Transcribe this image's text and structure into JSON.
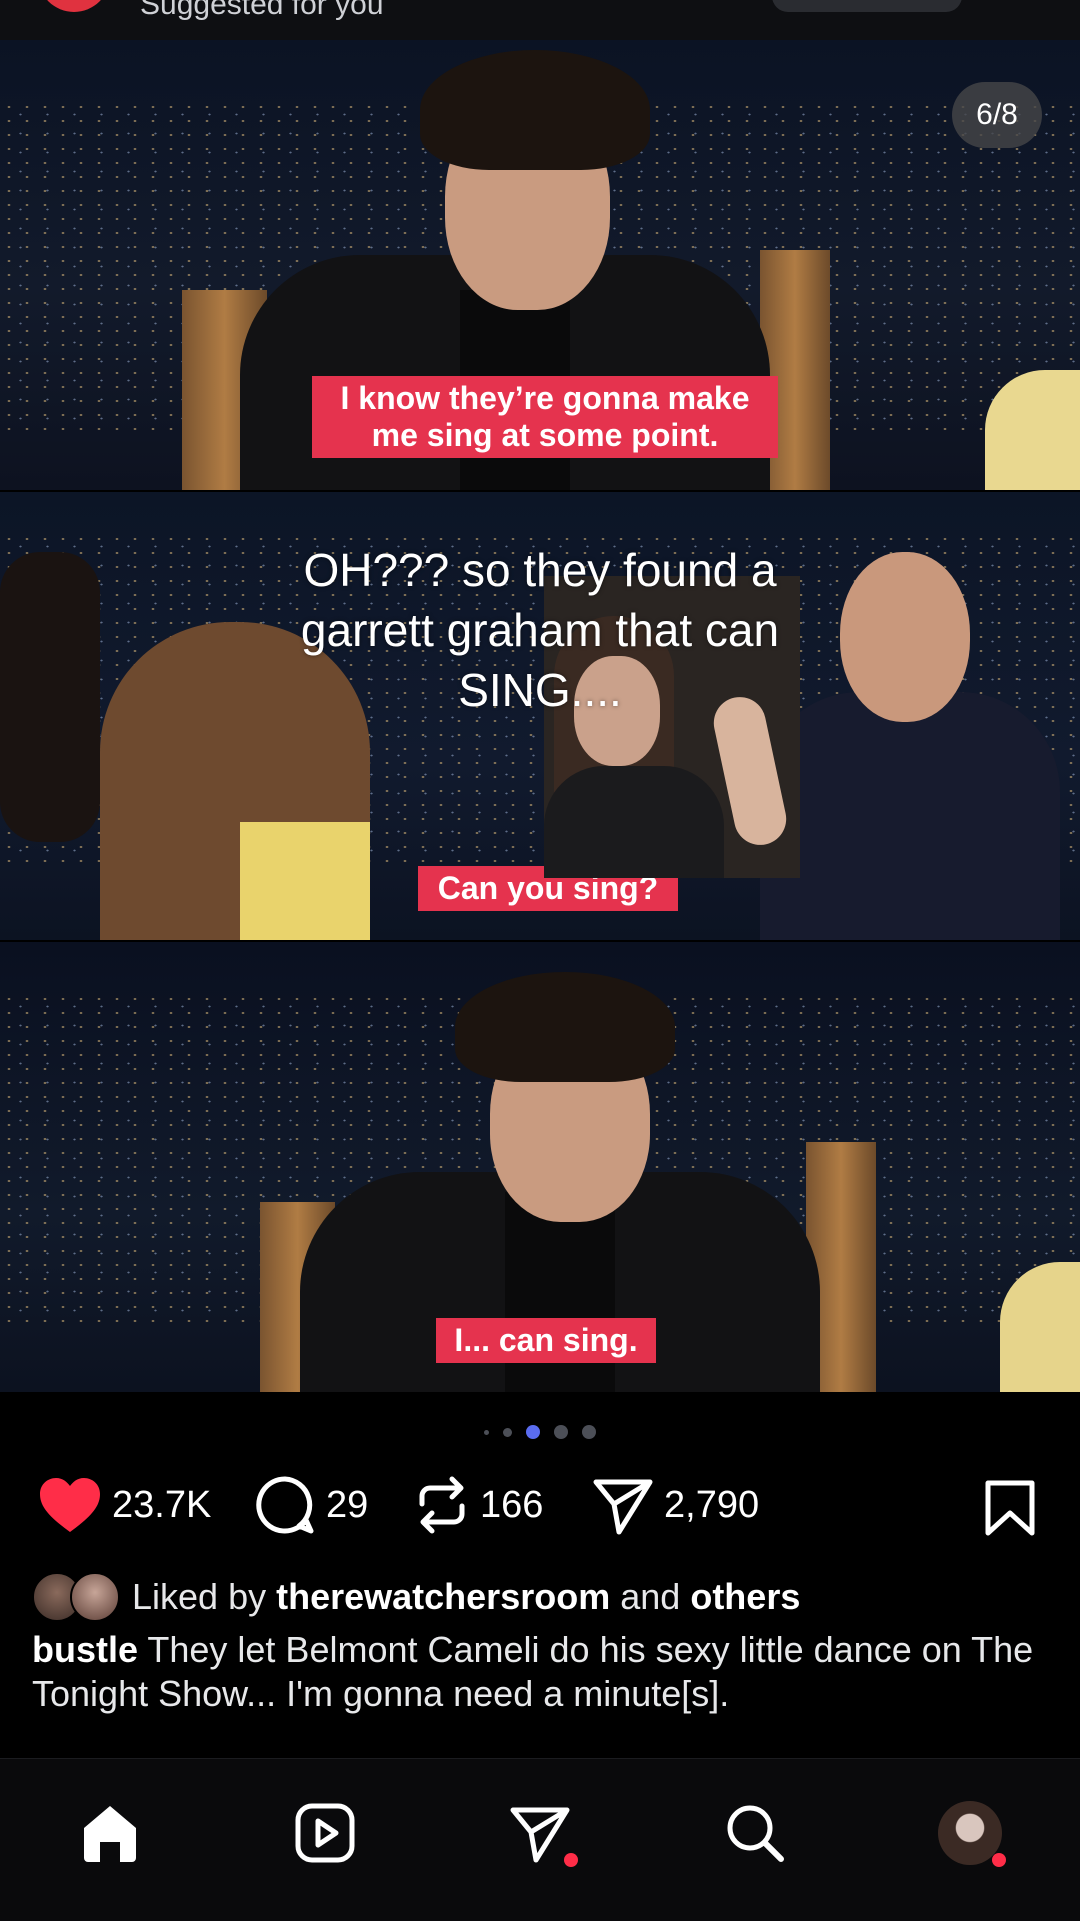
{
  "top_bar": {
    "label": "Suggested for you"
  },
  "media": {
    "counter": "6/8",
    "captions": [
      "I know they’re gonna make",
      "me sing at some point.",
      "Can you sing?",
      "I... can sing."
    ],
    "overlay_lines": [
      "OH??? so they found a",
      "garrett graham that can",
      "SING...."
    ]
  },
  "carousel": {
    "dots": 5,
    "active_index": 2
  },
  "actions": {
    "likes": "23.7K",
    "comments": "29",
    "reposts": "166",
    "shares": "2,790",
    "accent_color": "#ff2d48"
  },
  "liked_by": {
    "prefix": "Liked by",
    "user": "therewatchersroom",
    "middle": "and",
    "suffix": "others"
  },
  "post": {
    "author": "bustle",
    "caption": "They let Belmont Cameli do his sexy little dance on The Tonight Show... I'm gonna need a minute[s]."
  },
  "bottom_nav": {
    "items": [
      "home-icon",
      "reels-icon",
      "send-icon",
      "search-icon",
      "profile-avatar"
    ]
  }
}
